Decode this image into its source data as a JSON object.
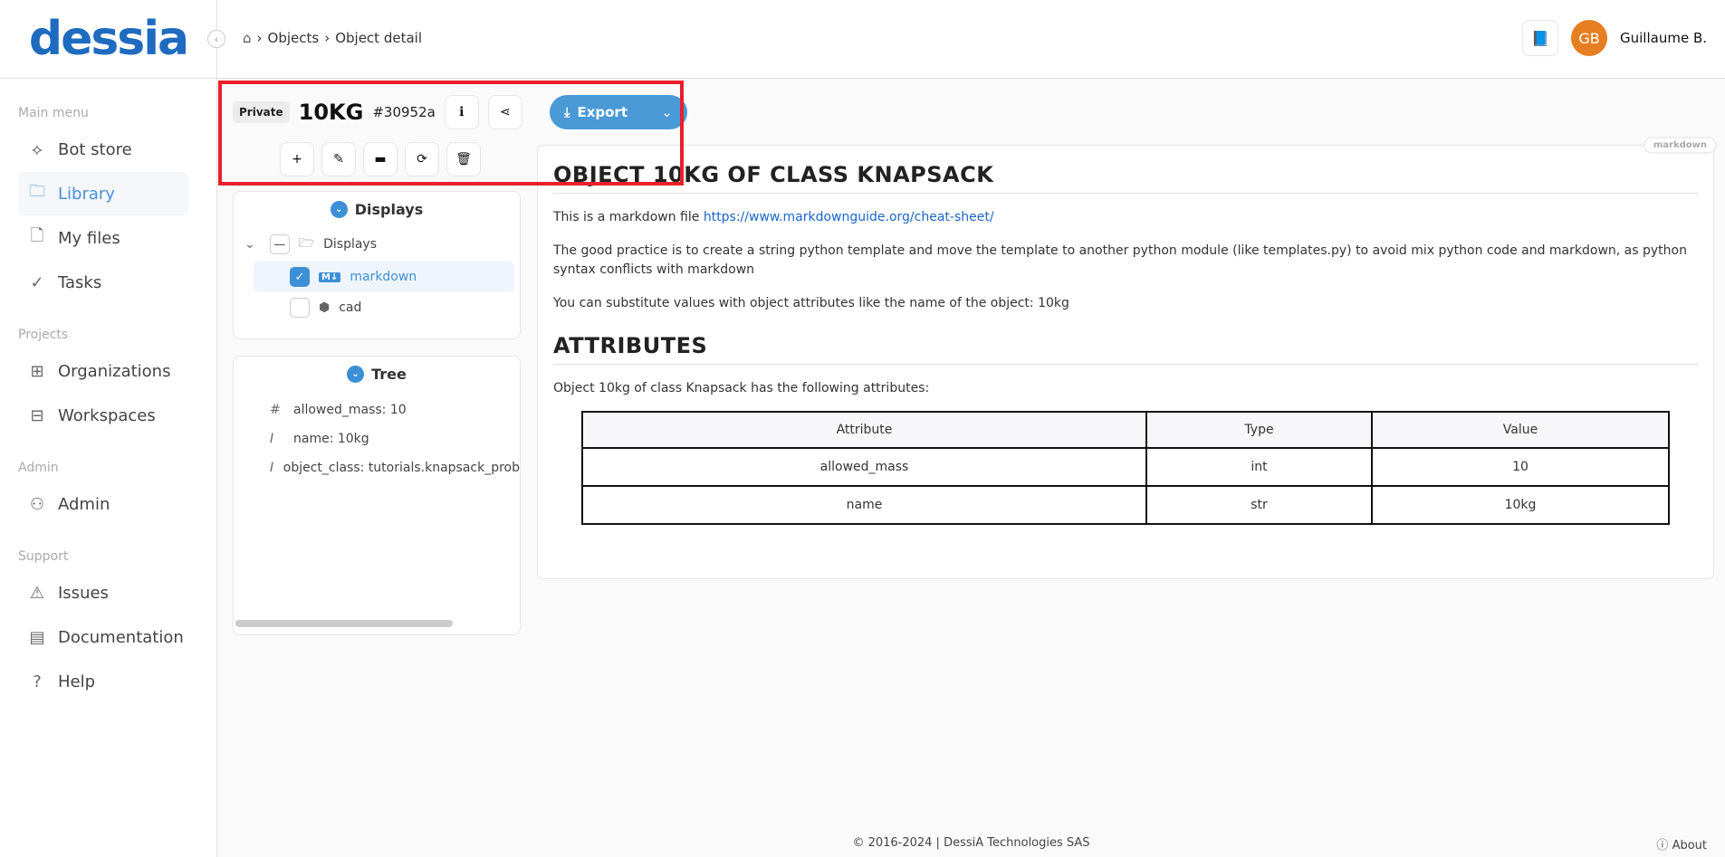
{
  "logo": "dessia",
  "sidebar": {
    "sections": [
      {
        "title": "Main menu",
        "items": [
          {
            "label": "Bot store",
            "icon": "bot-store-icon",
            "g": "⟡"
          },
          {
            "label": "Library",
            "icon": "folder-icon",
            "g": "🗀",
            "active": true
          },
          {
            "label": "My files",
            "icon": "file-icon",
            "g": "🗋"
          },
          {
            "label": "Tasks",
            "icon": "check-circle-icon",
            "g": "✓"
          }
        ]
      },
      {
        "title": "Projects",
        "items": [
          {
            "label": "Organizations",
            "icon": "org-chart-icon",
            "g": "⊞"
          },
          {
            "label": "Workspaces",
            "icon": "briefcase-icon",
            "g": "⊟"
          }
        ]
      },
      {
        "title": "Admin",
        "items": [
          {
            "label": "Admin",
            "icon": "user-gear-icon",
            "g": "⚇"
          }
        ]
      },
      {
        "title": "Support",
        "items": [
          {
            "label": "Issues",
            "icon": "warning-icon",
            "g": "⚠"
          },
          {
            "label": "Documentation",
            "icon": "document-icon",
            "g": "▤"
          },
          {
            "label": "Help",
            "icon": "help-icon",
            "g": "?"
          }
        ]
      }
    ]
  },
  "breadcrumb": {
    "items": [
      "Objects",
      "Object detail"
    ]
  },
  "user": {
    "initials": "GB",
    "name": "Guillaume B.",
    "avatar_color": "#e67e22"
  },
  "object": {
    "visibility": "Private",
    "name": "10KG",
    "id": "#30952a",
    "export_label": "Export"
  },
  "displays": {
    "title": "Displays",
    "root": "Displays",
    "items": [
      {
        "label": "markdown",
        "checked": true
      },
      {
        "label": "cad",
        "checked": false
      }
    ]
  },
  "tree": {
    "title": "Tree",
    "items": [
      {
        "glyph": "#",
        "label": "allowed_mass: 10"
      },
      {
        "glyph": "I",
        "label": "name: 10kg"
      },
      {
        "glyph": "I",
        "label": "object_class: tutorials.knapsack_prob"
      }
    ]
  },
  "content": {
    "tag": "markdown",
    "h1": "OBJECT 10KG OF CLASS KNAPSACK",
    "p1_text": "This is a markdown file ",
    "p1_link": "https://www.markdownguide.org/cheat-sheet/",
    "p2": "The good practice is to create a string python template and move the template to another python module (like templates.py) to avoid mix python code and markdown, as python syntax conflicts with markdown",
    "p3": "You can substitute values with object attributes like the name of the object: 10kg",
    "h2": "ATTRIBUTES",
    "p4": "Object 10kg of class Knapsack has the following attributes:",
    "table": {
      "headers": [
        "Attribute",
        "Type",
        "Value"
      ],
      "rows": [
        [
          "allowed_mass",
          "int",
          "10"
        ],
        [
          "name",
          "str",
          "10kg"
        ]
      ]
    }
  },
  "footer": {
    "copyright": "© 2016-2024 | DessiA Technologies SAS",
    "about": "About"
  },
  "colors": {
    "accent": "#4a9ad8",
    "highlight": "#e8202a"
  }
}
